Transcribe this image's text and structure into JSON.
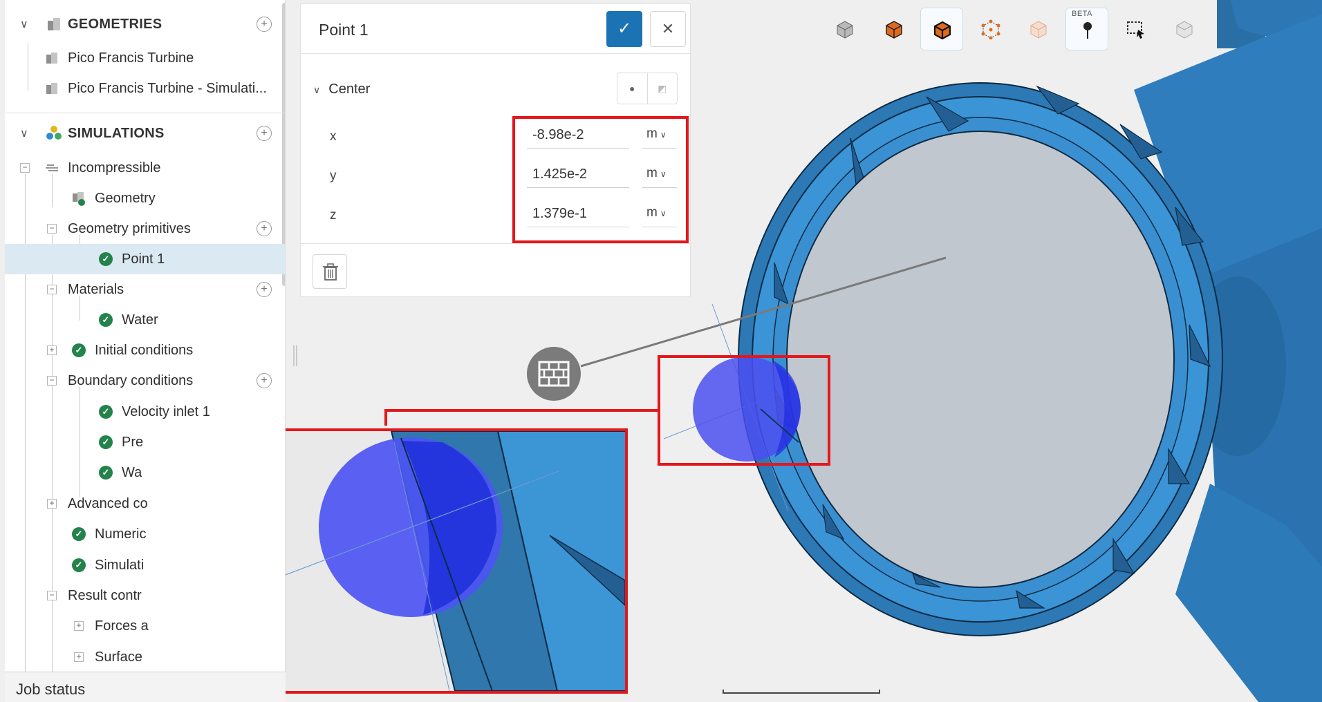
{
  "tree": {
    "geometries": {
      "title": "GEOMETRIES",
      "items": [
        "Pico Francis Turbine",
        "Pico Francis Turbine - Simulati..."
      ]
    },
    "simulations": {
      "title": "SIMULATIONS",
      "incompressible": "Incompressible",
      "geometry": "Geometry",
      "geometry_primitives": "Geometry primitives",
      "point1": "Point 1",
      "materials": "Materials",
      "water": "Water",
      "initial_conditions": "Initial conditions",
      "boundary_conditions": "Boundary conditions",
      "velocity_inlet": "Velocity inlet 1",
      "pressure_outlet": "Pre",
      "wall": "Wa",
      "advanced_concepts": "Advanced co",
      "numerics": "Numeric",
      "simulation_control": "Simulati",
      "result_control": "Result contr",
      "forces": "Forces a",
      "surface": "Surface"
    }
  },
  "job_status": "Job status",
  "panel": {
    "title": "Point 1",
    "confirm_icon": "check-icon",
    "close_icon": "close-icon",
    "section": "Center",
    "fields": [
      {
        "axis": "x",
        "value": "-8.98e-2",
        "unit": "m"
      },
      {
        "axis": "y",
        "value": "1.425e-2",
        "unit": "m"
      },
      {
        "axis": "z",
        "value": "1.379e-1",
        "unit": "m"
      }
    ]
  },
  "toolbar": {
    "beta_label": "BETA",
    "icons": [
      "cube-view-icon",
      "solid-cube-icon",
      "cube-edges-icon",
      "cube-vertices-icon",
      "transparent-cube-icon",
      "probe-point-icon",
      "box-select-icon",
      "hidden-parts-icon"
    ]
  },
  "colors": {
    "accent": "#1b73b3",
    "highlight": "#e4171b",
    "success": "#23834a",
    "geometry": "#3a8fd0",
    "sphere": "#4b4ff0"
  }
}
